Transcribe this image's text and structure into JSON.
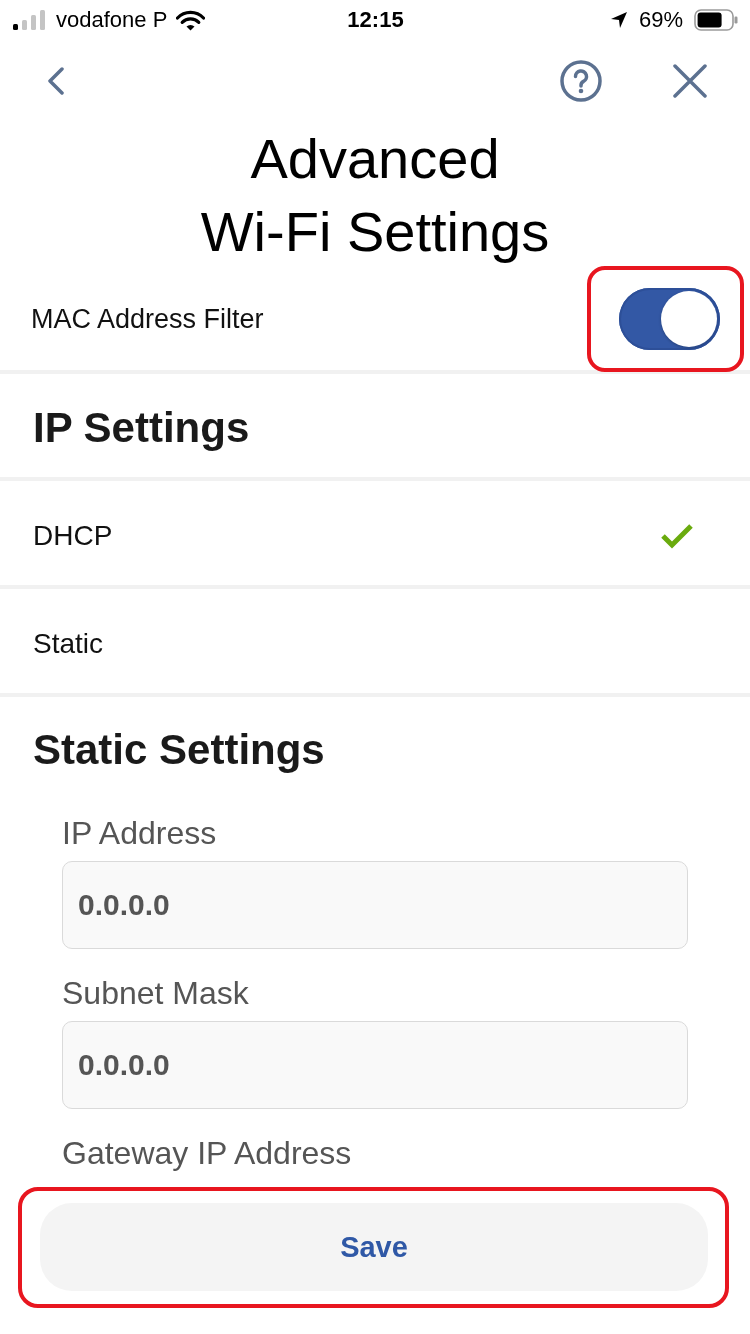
{
  "status_bar": {
    "carrier": "vodafone P",
    "time": "12:15",
    "battery": "69%"
  },
  "title": "Advanced Wi-Fi Settings",
  "mac_filter": {
    "label": "MAC Address Filter",
    "on": true,
    "highlighted": true
  },
  "ip_settings": {
    "heading": "IP Settings",
    "options": [
      {
        "label": "DHCP",
        "selected": true
      },
      {
        "label": "Static",
        "selected": false
      }
    ]
  },
  "static_settings": {
    "heading": "Static Settings",
    "fields": [
      {
        "label": "IP Address",
        "value": "0.0.0.0"
      },
      {
        "label": "Subnet Mask",
        "value": "0.0.0.0"
      },
      {
        "label": "Gateway IP Address"
      }
    ]
  },
  "save_button": {
    "label": "Save",
    "highlighted": true
  }
}
